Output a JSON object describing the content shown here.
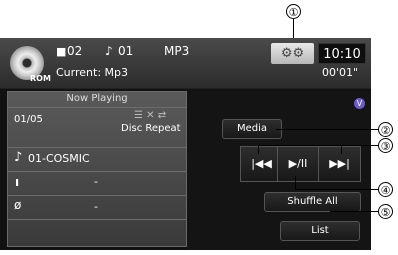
{
  "header": {
    "source_label": "ROM",
    "folder_num": "02",
    "track_num": "01",
    "format": "MP3",
    "current_label": "Current: Mp3",
    "clock": "10:10",
    "elapsed": "00'01\"",
    "folder_icon": "folder-icon",
    "note_icon": "music-note-icon",
    "settings_icon": "gear-icon"
  },
  "now_playing": {
    "heading": "Now Playing",
    "track_index": "01/05",
    "repeat_mode": "Disc Repeat",
    "track_title": "01-COSMIC",
    "artist": "-",
    "album": "-"
  },
  "controls": {
    "media_label": "Media",
    "prev_glyph": "|◀◀",
    "play_pause_glyph": "▶/II",
    "next_glyph": "▶▶|",
    "shuffle_label": "Shuffle All",
    "list_label": "List",
    "badge": "V"
  },
  "callouts": [
    "①",
    "②",
    "③",
    "④",
    "⑤"
  ]
}
